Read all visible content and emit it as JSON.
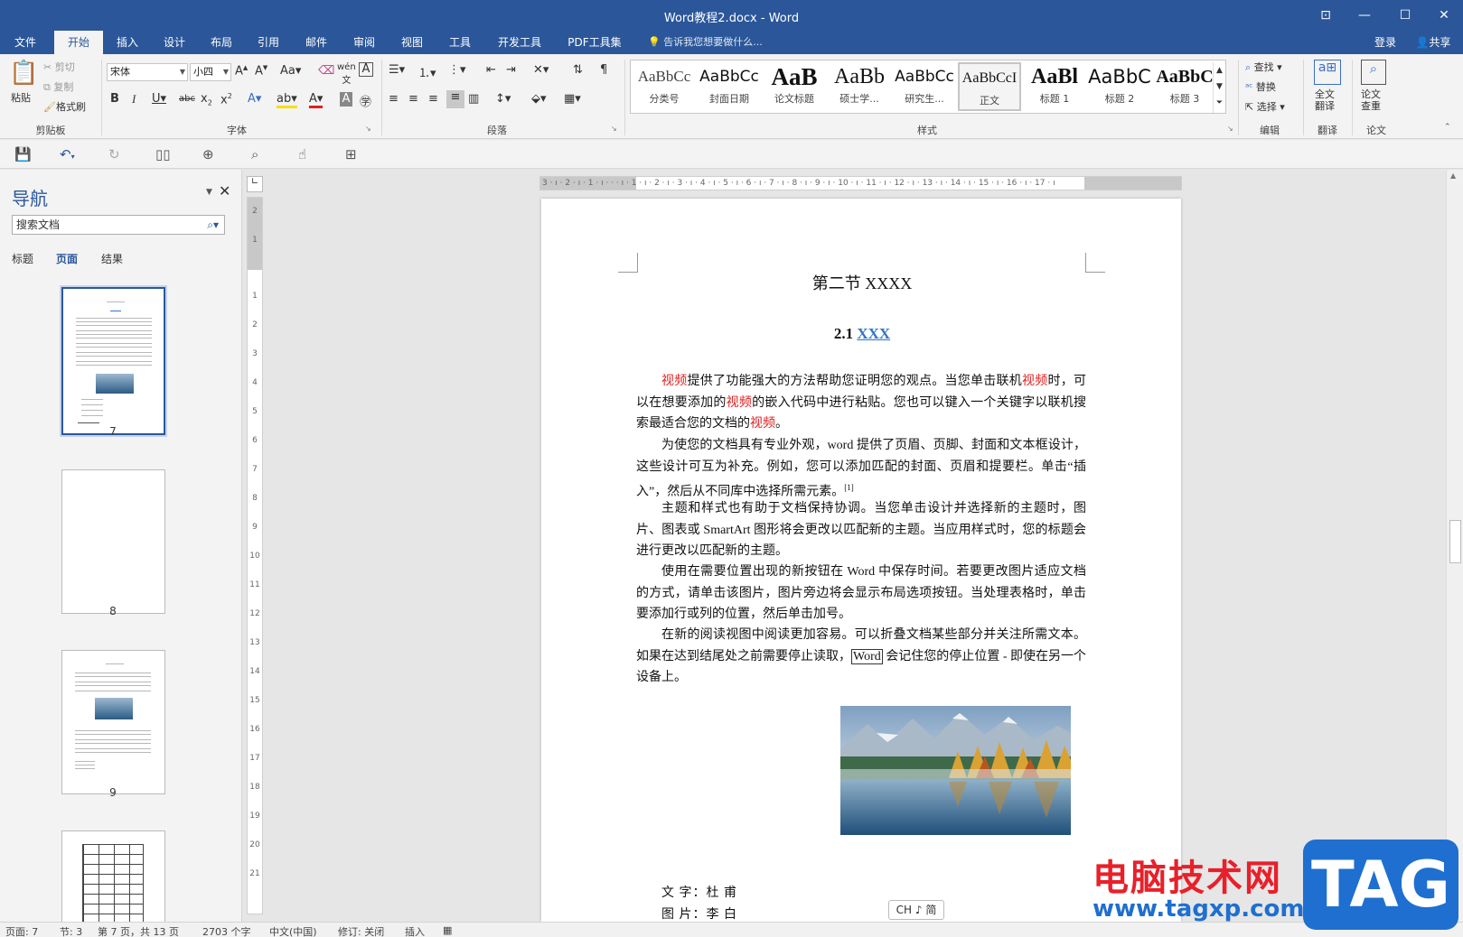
{
  "window": {
    "title": "Word教程2.docx - Word"
  },
  "tabs": [
    "文件",
    "开始",
    "插入",
    "设计",
    "布局",
    "引用",
    "邮件",
    "审阅",
    "视图",
    "工具",
    "开发工具",
    "PDF工具集"
  ],
  "active_tab": "开始",
  "tellme": "告诉我您想要做什么...",
  "account": {
    "login": "登录",
    "share": "共享"
  },
  "ribbon": {
    "clipboard": {
      "paste": "粘贴",
      "cut": "剪切",
      "copy": "复制",
      "format_painter": "格式刷",
      "label": "剪贴板"
    },
    "font": {
      "name": "宋体",
      "size": "小四",
      "label": "字体"
    },
    "paragraph": {
      "label": "段落"
    },
    "styles": {
      "label": "样式",
      "items": [
        {
          "sample": "AaBbCc",
          "name": "分类号"
        },
        {
          "sample": "AaBbCc",
          "name": "封面日期"
        },
        {
          "sample": "AaB",
          "name": "论文标题"
        },
        {
          "sample": "AaBb",
          "name": "硕士学..."
        },
        {
          "sample": "AaBbCc",
          "name": "研究生..."
        },
        {
          "sample": "AaBbCcI",
          "name": "正文"
        },
        {
          "sample": "AaBl",
          "name": "标题 1"
        },
        {
          "sample": "AaBbC",
          "name": "标题 2"
        },
        {
          "sample": "AaBbC",
          "name": "标题 3"
        }
      ]
    },
    "editing": {
      "find": "查找",
      "replace": "替换",
      "select": "选择",
      "label": "编辑"
    },
    "translate": {
      "button": "全文\n翻译",
      "label": "翻译"
    },
    "paper": {
      "button": "论文\n查重",
      "label": "论文"
    }
  },
  "nav": {
    "title": "导航",
    "search_placeholder": "搜索文档",
    "tabs": [
      "标题",
      "页面",
      "结果"
    ],
    "active_tab": "页面",
    "pages": [
      "7",
      "8",
      "9"
    ]
  },
  "ruler": {
    "h": "3 · ı · 2 · ı · 1 · ı · · · ı · 1 · ı · 2 · ı · 3 · ı · 4 · ı · 5 · ı · 6 · ı · 7 · ı · 8 · ı · 9 · ı · 10 · ı · 11 · ı · 12 · ı · 13 · ı · 14 · ı · 15 · ı · 16 · ı · 17 · ı",
    "v": [
      "2",
      "1",
      "1",
      "1",
      "2",
      "3",
      "4",
      "5",
      "6",
      "7",
      "8",
      "9",
      "10",
      "11",
      "12",
      "13",
      "14",
      "15",
      "16",
      "17",
      "18",
      "19",
      "20",
      "21"
    ]
  },
  "document": {
    "section_title": "第二节  XXXX",
    "heading_num": "2.1 ",
    "heading_link": "XXX",
    "p1": {
      "a": "视频",
      "b": "提供了功能强大的方法帮助您证明您的观点。当您单击联机",
      "c": "视频",
      "d": "时，可以在想要添加的",
      "e": "视频",
      "f": "的嵌入代码中进行粘贴。您也可以键入一个关键字以联机搜索最适合您的文档的",
      "g": "视频",
      "h": "。"
    },
    "p2": {
      "text": "为使您的文档具有专业外观，word 提供了页眉、页脚、封面和文本框设计，这些设计可互为补充。例如，您可以添加匹配的封面、页眉和提要栏。单击“插入”，然后从不同库中选择所需元素。",
      "footnote": "[1]"
    },
    "p3": "主题和样式也有助于文档保持协调。当您单击设计并选择新的主题时，图片、图表或 SmartArt 图形将会更改以匹配新的主题。当应用样式时，您的标题会进行更改以匹配新的主题。",
    "p4": "使用在需要位置出现的新按钮在 Word 中保存时间。若要更改图片适应文档的方式，请单击该图片，图片旁边将会显示布局选项按钮。当处理表格时，单击要添加行或列的位置，然后单击加号。",
    "p5": {
      "a": "在新的阅读视图中阅读更加容易。可以折叠文档某些部分并关注所需文本。如果在达到结尾处之前需要停止读取，",
      "b": "Word",
      "c": " 会记住您的停止位置 - 即使在另一个设备上。"
    },
    "credit1": "文 字：杜    甫",
    "credit2": "图 片：李    白"
  },
  "ime": "CH ♪ 简",
  "status": {
    "page": "页面: 7",
    "section": "节: 3",
    "pages": "第 7 页，共 13 页",
    "words": "2703 个字",
    "lang": "中文(中国)",
    "track": "修订: 关闭",
    "insert": "插入"
  },
  "watermark": {
    "text": "电脑技术网",
    "url": "www.tagxp.com",
    "tag": "TAG"
  },
  "colors": {
    "accent": "#2b579a",
    "red_text": "#e02020",
    "link": "#2e74c8",
    "wm_red": "#e8202a",
    "wm_blue": "#1e6fd0"
  }
}
